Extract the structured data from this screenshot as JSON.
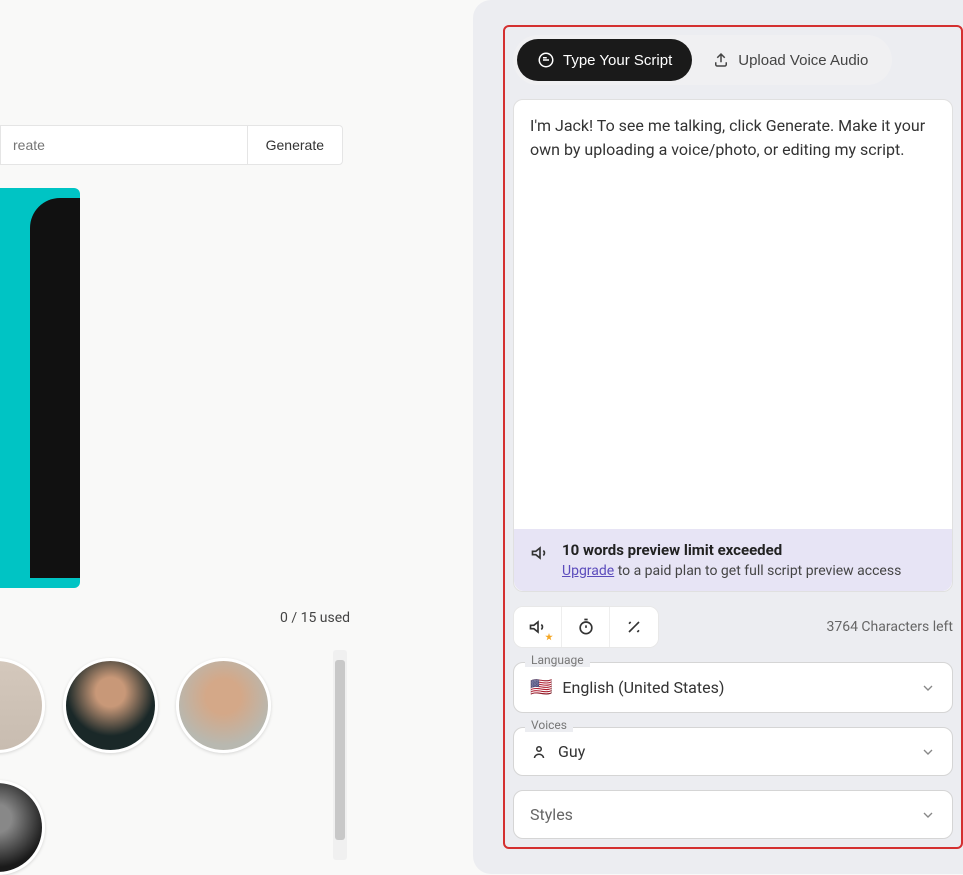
{
  "left": {
    "input_placeholder": "reate",
    "generate_label": "Generate",
    "used_text": "0 / 15 used"
  },
  "tabs": {
    "type_script": "Type Your Script",
    "upload_audio": "Upload Voice Audio"
  },
  "script": {
    "value": "I'm Jack! To see me talking, click Generate. Make it your own by uploading a voice/photo, or editing my script."
  },
  "warning": {
    "title": "10 words preview limit exceeded",
    "upgrade": "Upgrade",
    "rest": " to a paid plan to get full script preview access"
  },
  "chars_left": "3764 Characters left",
  "language": {
    "label": "Language",
    "flag": "🇺🇸",
    "value": "English (United States)"
  },
  "voices": {
    "label": "Voices",
    "value": "Guy"
  },
  "styles": {
    "placeholder": "Styles"
  }
}
